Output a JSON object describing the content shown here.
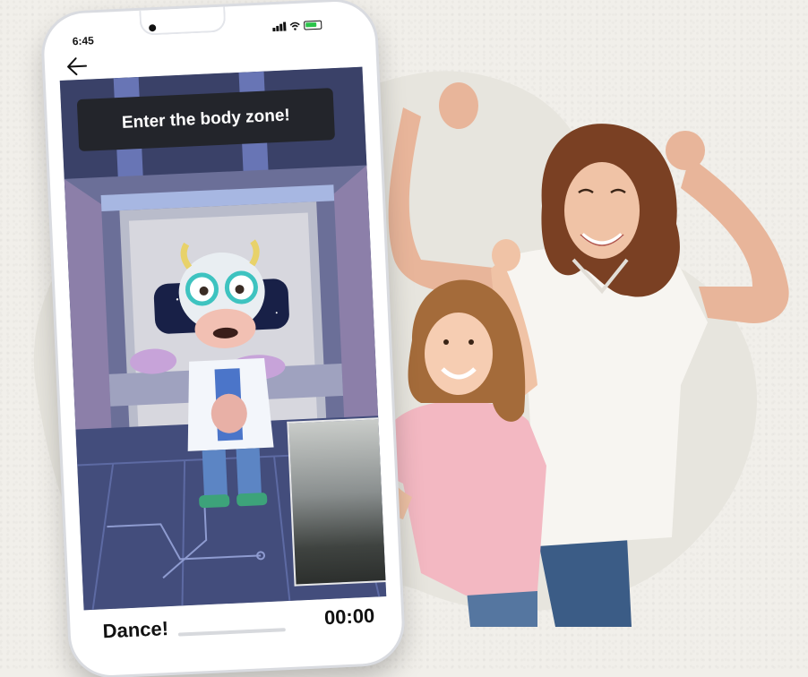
{
  "status_bar": {
    "time": "6:45"
  },
  "screen": {
    "banner_text": "Enter the body zone!",
    "activity_label": "Dance!",
    "timer": "00:00"
  },
  "icons": {
    "back": "arrow-left-icon",
    "signal": "cellular-signal-icon",
    "wifi": "wifi-icon",
    "battery": "battery-icon"
  },
  "colors": {
    "banner_bg": "#23252b",
    "battery_fill": "#2bc44a",
    "blob": "#e7e5de",
    "room": "#3c466e"
  }
}
